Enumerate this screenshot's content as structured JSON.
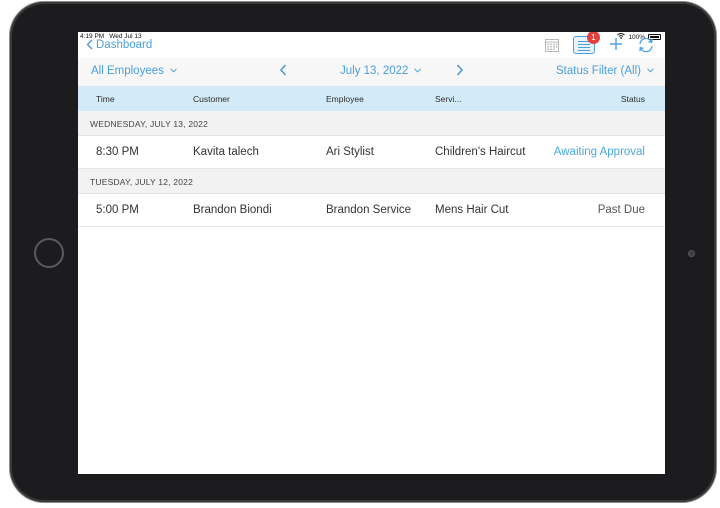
{
  "status_bar": {
    "time": "4:19 PM",
    "date": "Wed Jul 13",
    "battery": "100%"
  },
  "nav": {
    "back_label": "Dashboard",
    "badge_count": "1"
  },
  "filters": {
    "employee_filter": "All Employees",
    "date": "July 13, 2022",
    "status_filter": "Status Filter (All)"
  },
  "table": {
    "columns": [
      "Time",
      "Customer",
      "Employee",
      "Servi...",
      "Status"
    ],
    "sections": [
      {
        "header": "WEDNESDAY, JULY 13, 2022",
        "rows": [
          {
            "time": "8:30 PM",
            "customer": "Kavita talech",
            "employee": "Ari Stylist",
            "service": "Children's Haircut",
            "status": "Awaiting Approval"
          }
        ]
      },
      {
        "header": "TUESDAY, JULY 12, 2022",
        "rows": [
          {
            "time": "5:00 PM",
            "customer": "Brandon Biondi",
            "employee": "Brandon Service",
            "service": "Mens Hair Cut",
            "status": "Past Due"
          }
        ]
      }
    ]
  },
  "colors": {
    "accent": "#4a9fdc",
    "header_bg": "#d3ebf8",
    "badge": "#e0413c",
    "device": "#1c1c1e"
  },
  "icons": [
    "chevron-left-icon",
    "calendar-icon",
    "list-icon",
    "plus-icon",
    "sync-icon",
    "wifi-icon",
    "battery-icon",
    "chevron-down-icon",
    "chevron-right-icon"
  ]
}
